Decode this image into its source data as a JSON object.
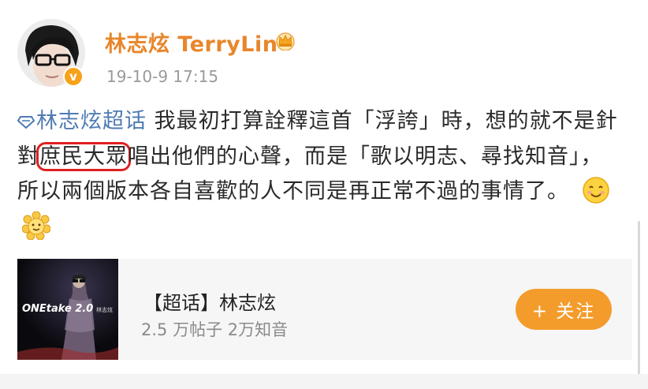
{
  "post": {
    "username": "林志炫 TerryLin",
    "timestamp": "19-10-9 17:15",
    "topic_tag": "林志炫超话",
    "text_part1": " 我最初打算詮釋這首「浮誇」時，想的就不是針對",
    "text_highlight": "庶民大眾",
    "text_part2": "唱出他們的心聲，而是「歌以明志、尋找知音」，所以兩個版本各自喜歡的人不同是再正常不過的事情了。"
  },
  "card": {
    "thumb_text": "ONEtake 2.0",
    "thumb_small": "林志炫",
    "title": "【超话】林志炫",
    "subtitle": "2.5 万帖子 2万知音",
    "follow_label": "+ 关注"
  },
  "icons": {
    "verified": "v",
    "crown": "crown-icon",
    "topic": "diamond-topic-icon",
    "emoji1": "smile-emoji",
    "emoji2": "flower-emoji"
  },
  "colors": {
    "username": "#e8862a",
    "topic": "#4f7bb3",
    "highlight_box": "#e02020",
    "follow_button": "#f39c2c"
  }
}
